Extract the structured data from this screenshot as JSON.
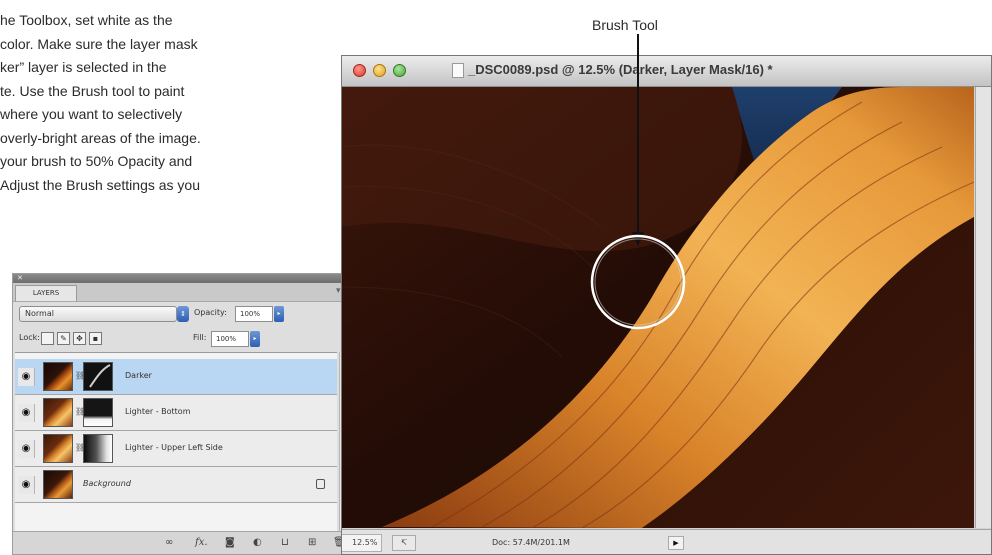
{
  "instructions": {
    "lines": [
      "he Toolbox, set white as the",
      "color. Make sure the layer mask",
      "ker” layer is selected in the",
      "te. Use the Brush tool to paint",
      "where you want to selectively",
      "overly-bright areas of the image.",
      "your brush to 50% Opacity and",
      "Adjust the Brush settings as you"
    ]
  },
  "callout": {
    "label": "Brush Tool"
  },
  "layers_panel": {
    "tab": "LAYERS",
    "blend_mode": "Normal",
    "opacity_label": "Opacity:",
    "opacity_value": "100%",
    "lock_label": "Lock:",
    "fill_label": "Fill:",
    "fill_value": "100%",
    "layers": [
      {
        "name": "Darker",
        "selected": true
      },
      {
        "name": "Lighter - Bottom",
        "selected": false
      },
      {
        "name": "Lighter - Upper Left Side",
        "selected": false
      },
      {
        "name": "Background",
        "selected": false
      }
    ],
    "footer_icons": [
      "link-icon",
      "fx-icon",
      "mask-icon",
      "adjustment-icon",
      "folder-icon",
      "new-layer-icon",
      "trash-icon"
    ]
  },
  "document_window": {
    "title": "_DSC0089.psd @ 12.5% (Darker, Layer Mask/16) *",
    "zoom": "12.5%",
    "doc_info": "Doc: 57.4M/201.1M"
  }
}
